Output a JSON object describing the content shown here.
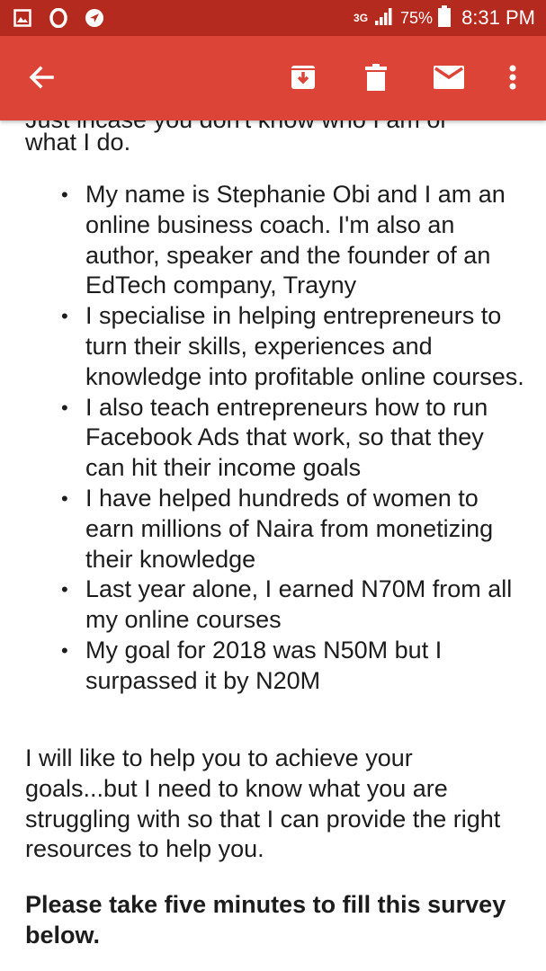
{
  "status_bar": {
    "network_type": "3G",
    "battery": "75%",
    "time": "8:31 PM"
  },
  "app_bar": {
    "back_icon": "arrow-left-icon",
    "archive_icon": "archive-icon",
    "delete_icon": "trash-icon",
    "mark_unread_icon": "envelope-icon",
    "more_icon": "more-vert-icon",
    "background": "#db4437",
    "status_background": "#b52a1f"
  },
  "email": {
    "partial_line": "Just incase you don't know who I am or",
    "intro_end": "what I do.",
    "points": [
      "My name is Stephanie Obi and I am an online business coach. I'm also an author, speaker and the founder of an EdTech company, Trayny",
      "I specialise in helping entrepreneurs to turn their skills, experiences and knowledge into profitable online courses.",
      "I also teach entrepreneurs how to run Facebook Ads that work, so that they can hit their income goals",
      "I have helped hundreds of women to earn millions of Naira from monetizing their knowledge",
      "Last year alone, I earned N70M from all my online courses",
      "My goal for 2018 was N50M but I surpassed it by N20M"
    ],
    "help_paragraph": "I will like to help you to achieve your goals...but I need to know what you are struggling with so that I can provide the right resources to help you.",
    "cta": "Please take five minutes to fill this survey below."
  }
}
